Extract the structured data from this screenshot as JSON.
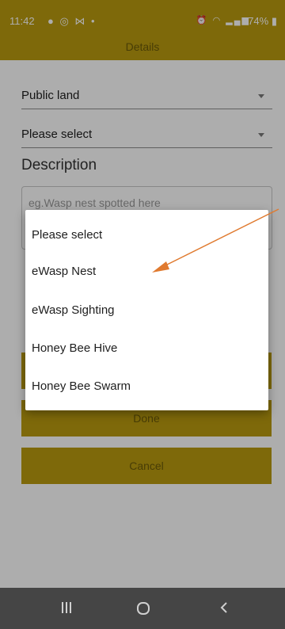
{
  "status_bar": {
    "time": "11:42",
    "left_icons": "● ◎ ⋈ •",
    "battery": "74%"
  },
  "header": {
    "title": "Details"
  },
  "form": {
    "land_select": "Public land",
    "type_select": "Please select",
    "description_label": "Description",
    "description_placeholder": "eg.Wasp nest spotted here"
  },
  "buttons": {
    "done": "Done",
    "cancel": "Cancel"
  },
  "dialog": {
    "options": [
      {
        "label": "Please select"
      },
      {
        "label": "eWasp Nest"
      },
      {
        "label": "eWasp Sighting"
      },
      {
        "label": "Honey Bee Hive"
      },
      {
        "label": "Honey Bee Swarm"
      }
    ]
  },
  "colors": {
    "brand": "#ba9b0f",
    "annotation_arrow": "#e07a2f"
  }
}
